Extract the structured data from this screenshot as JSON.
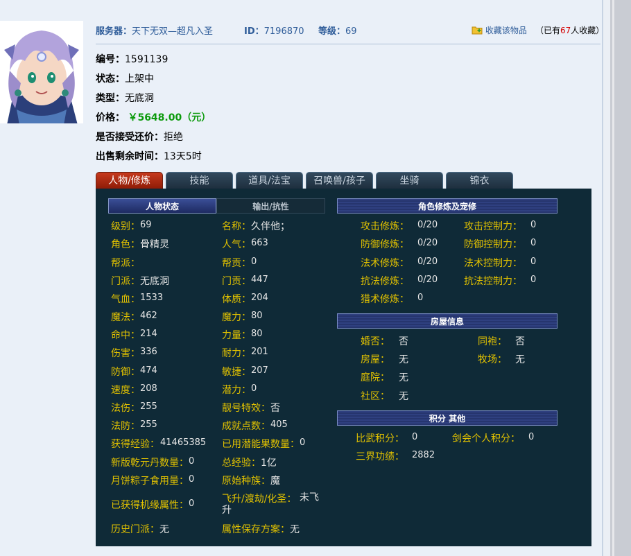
{
  "header": {
    "server_label": "服务器：",
    "server_value": "天下无双—超凡入圣",
    "id_label": "ID：",
    "id_value": "7196870",
    "level_label": "等级：",
    "level_value": "69",
    "favorite_label": "收藏该物品",
    "fav_prefix": "（已有",
    "fav_count": "67",
    "fav_suffix": "人收藏）"
  },
  "item": {
    "serial_label": "编号：",
    "serial_value": "1591139",
    "status_label": "状态：",
    "status_value": "上架中",
    "type_label": "类型：",
    "type_value": "无底洞",
    "price_label": "价格：",
    "price_value": "￥5648.00（元）",
    "bargain_label": "是否接受还价：",
    "bargain_value": "拒绝",
    "time_label": "出售剩余时间：",
    "time_value": "13天5时"
  },
  "tabs": [
    "人物/修炼",
    "技能",
    "道具/法宝",
    "召唤兽/孩子",
    "坐骑",
    "锦衣"
  ],
  "sub_tabs": [
    "人物状态",
    "输出/抗性"
  ],
  "stats_left": [
    {
      "label": "级别：",
      "value": "69"
    },
    {
      "label": "角色：",
      "value": "骨精灵"
    },
    {
      "label": "帮派：",
      "value": ""
    },
    {
      "label": "门派：",
      "value": "无底洞"
    },
    {
      "label": "气血：",
      "value": "1533"
    },
    {
      "label": "魔法：",
      "value": "462"
    },
    {
      "label": "命中：",
      "value": "214"
    },
    {
      "label": "伤害：",
      "value": "336"
    },
    {
      "label": "防御：",
      "value": "474"
    },
    {
      "label": "速度：",
      "value": "208"
    },
    {
      "label": "法伤：",
      "value": "255"
    },
    {
      "label": "法防：",
      "value": "255"
    },
    {
      "label": "获得经验：",
      "value": "41465385"
    },
    {
      "label": "新版乾元丹数量：",
      "value": "0"
    },
    {
      "label": "月饼粽子食用量：",
      "value": "0"
    },
    {
      "label": "已获得机缘属性：",
      "value": "0"
    },
    {
      "label": "历史门派：",
      "value": "无"
    }
  ],
  "stats_right": [
    {
      "label": "名称：",
      "value": "久伴他；"
    },
    {
      "label": "人气：",
      "value": "663"
    },
    {
      "label": "帮贡：",
      "value": "0"
    },
    {
      "label": "门贡：",
      "value": "447"
    },
    {
      "label": "体质：",
      "value": "204"
    },
    {
      "label": "魔力：",
      "value": "80"
    },
    {
      "label": "力量：",
      "value": "80"
    },
    {
      "label": "耐力：",
      "value": "201"
    },
    {
      "label": "敏捷：",
      "value": "207"
    },
    {
      "label": "潜力：",
      "value": "0"
    },
    {
      "label": "靓号特效：",
      "value": "否"
    },
    {
      "label": "成就点数：",
      "value": "405"
    },
    {
      "label": "已用潜能果数量：",
      "value": "0"
    },
    {
      "label": "总经验：",
      "value": "1亿"
    },
    {
      "label": "原始种族：",
      "value": "魔"
    },
    {
      "label": "飞升/渡劫/化圣：",
      "value": "未飞升"
    },
    {
      "label": "属性保存方案：",
      "value": "无"
    }
  ],
  "cultivation": {
    "title": "角色修炼及宠修",
    "rows": [
      {
        "label": "攻击修炼：",
        "value": "0/20",
        "label2": "攻击控制力：",
        "value2": "0"
      },
      {
        "label": "防御修炼：",
        "value": "0/20",
        "label2": "防御控制力：",
        "value2": "0"
      },
      {
        "label": "法术修炼：",
        "value": "0/20",
        "label2": "法术控制力：",
        "value2": "0"
      },
      {
        "label": "抗法修炼：",
        "value": "0/20",
        "label2": "抗法控制力：",
        "value2": "0"
      },
      {
        "label": "猎术修炼：",
        "value": "0"
      }
    ]
  },
  "house": {
    "title": "房屋信息",
    "rows": [
      {
        "label": "婚否：",
        "value": "否",
        "label2": "同袍：",
        "value2": "否"
      },
      {
        "label": "房屋：",
        "value": "无",
        "label2": "牧场：",
        "value2": "无"
      },
      {
        "label": "庭院：",
        "value": "无"
      },
      {
        "label": "社区：",
        "value": "无"
      }
    ]
  },
  "points": {
    "title": "积分 其他",
    "rows": [
      {
        "label": "比武积分：",
        "value": "0",
        "label2": "剑会个人积分：",
        "value2": "0"
      },
      {
        "label": "三界功绩：",
        "value": "2882"
      }
    ]
  },
  "colors": {
    "label": "#e2c200",
    "panel": "#0f2a37",
    "tab_active": "#c63a1e",
    "price": "#0b9a0b",
    "link": "#2e5c99"
  }
}
